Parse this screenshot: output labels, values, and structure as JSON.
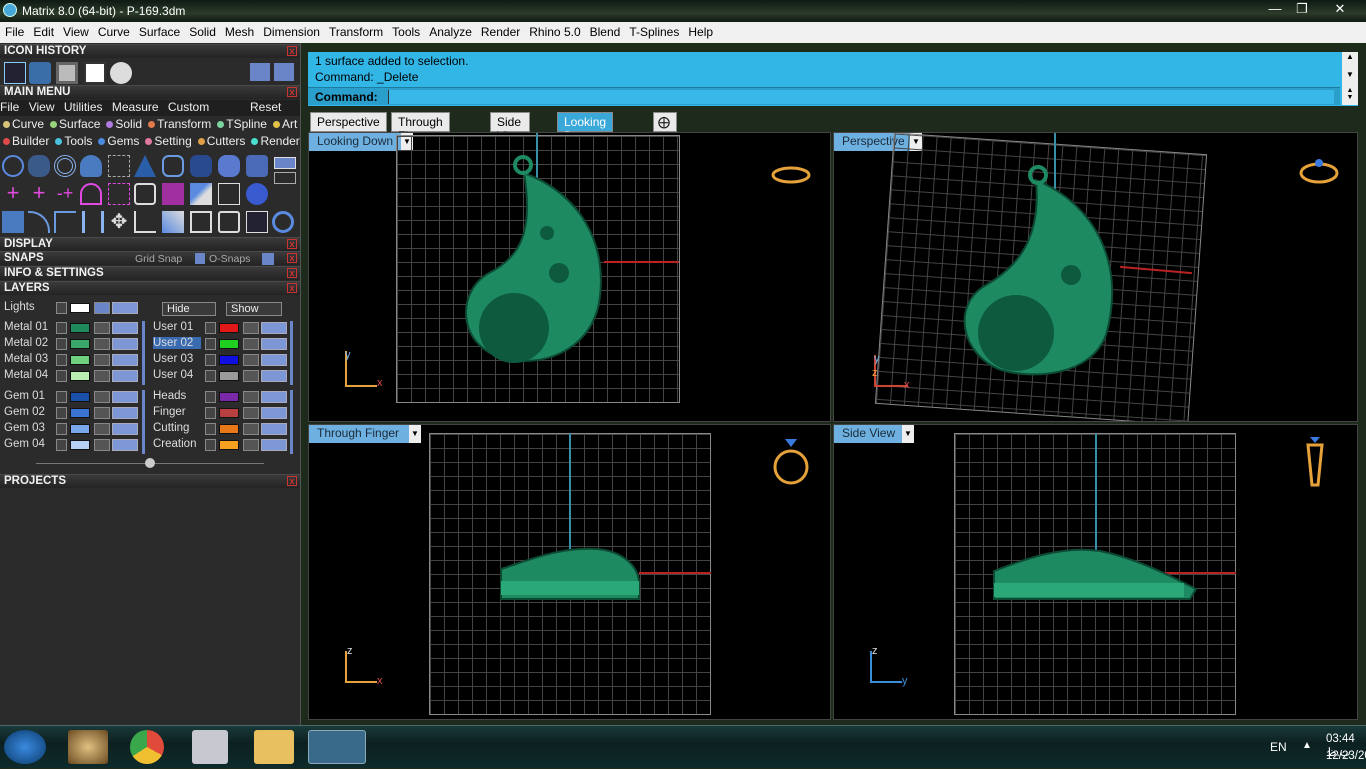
{
  "window": {
    "title": "Matrix 8.0 (64-bit) - P-169.3dm"
  },
  "menubar": [
    "File",
    "Edit",
    "View",
    "Curve",
    "Surface",
    "Solid",
    "Mesh",
    "Dimension",
    "Transform",
    "Tools",
    "Analyze",
    "Render",
    "Rhino 5.0",
    "Blend",
    "T-Splines",
    "Help"
  ],
  "panels": {
    "icon_history": "ICON HISTORY",
    "main_menu": "MAIN MENU",
    "display": "DISPLAY",
    "snaps": "SNAPS",
    "grid_snap": "Grid Snap",
    "o_snaps": "O-Snaps",
    "info_settings": "INFO & SETTINGS",
    "layers": "LAYERS",
    "projects": "PROJECTS"
  },
  "main_menu_items": [
    "File",
    "View",
    "Utilities",
    "Measure",
    "Custom"
  ],
  "main_menu_reset": "Reset",
  "category_row1": [
    "Curve",
    "Surface",
    "Solid",
    "Transform",
    "TSpline",
    "Art"
  ],
  "category_row2": [
    "Builder",
    "Tools",
    "Gems",
    "Setting",
    "Cutters",
    "Render"
  ],
  "lights": "Lights",
  "hide": "Hide",
  "show": "Show",
  "layers_left": [
    "Metal 01",
    "Metal 02",
    "Metal 03",
    "Metal 04",
    "Gem 01",
    "Gem 02",
    "Gem 03",
    "Gem 04"
  ],
  "layers_right": [
    "User 01",
    "User 02",
    "User 03",
    "User 04",
    "Heads",
    "Finger",
    "Cutting",
    "Creation"
  ],
  "colors": {
    "accent": "#31b6e6",
    "metal_layers": [
      "#1f8a5a",
      "#3aa86a",
      "#6fd07f",
      "#b8f0b0"
    ],
    "gem_layers": [
      "#1a4faa",
      "#3a74d0",
      "#7aa6ea",
      "#b6cff5"
    ],
    "user_layers": [
      "#e01818",
      "#20d020",
      "#1010e0",
      "#9a9a9a"
    ],
    "special_layers": [
      "#7a2aa8",
      "#b84040",
      "#e87818",
      "#f5a020"
    ],
    "model": "#1e8a62"
  },
  "command": {
    "line1": "1 surface added to selection.",
    "line2": "Command: _Delete",
    "prompt": "Command:"
  },
  "tabs": [
    "Perspective",
    "Through Finger",
    "Side View",
    "Looking Down"
  ],
  "active_tab": "Looking Down",
  "viewports": [
    {
      "label": "Looking Down",
      "axis1": "y",
      "axis2": "x"
    },
    {
      "label": "Perspective",
      "axis1": "y",
      "axis2": "z",
      "axis3": "x"
    },
    {
      "label": "Through Finger",
      "axis1": "z",
      "axis2": "x"
    },
    {
      "label": "Side View",
      "axis1": "z",
      "axis2": "y"
    }
  ],
  "tray": {
    "lang": "EN",
    "time": "03:44 ب.ظ",
    "date": "12/23/2022"
  }
}
